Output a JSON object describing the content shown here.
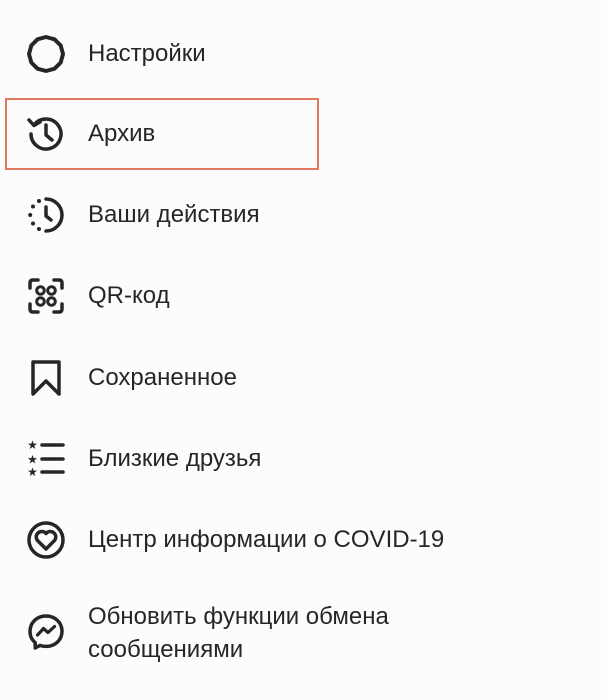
{
  "menu": {
    "items": [
      {
        "label": "Настройки",
        "icon": "settings-gear-icon"
      },
      {
        "label": "Архив",
        "icon": "archive-history-icon",
        "highlighted": true
      },
      {
        "label": "Ваши действия",
        "icon": "your-activity-icon"
      },
      {
        "label": "QR-код",
        "icon": "qr-code-icon"
      },
      {
        "label": "Сохраненное",
        "icon": "bookmark-icon"
      },
      {
        "label": "Близкие друзья",
        "icon": "close-friends-list-icon"
      },
      {
        "label": "Центр информации о COVID-19",
        "icon": "covid-info-center-icon"
      },
      {
        "label": "Обновить функции обмена\nсообщениями",
        "icon": "messenger-icon"
      }
    ],
    "highlight_color": "#e07a5f"
  }
}
